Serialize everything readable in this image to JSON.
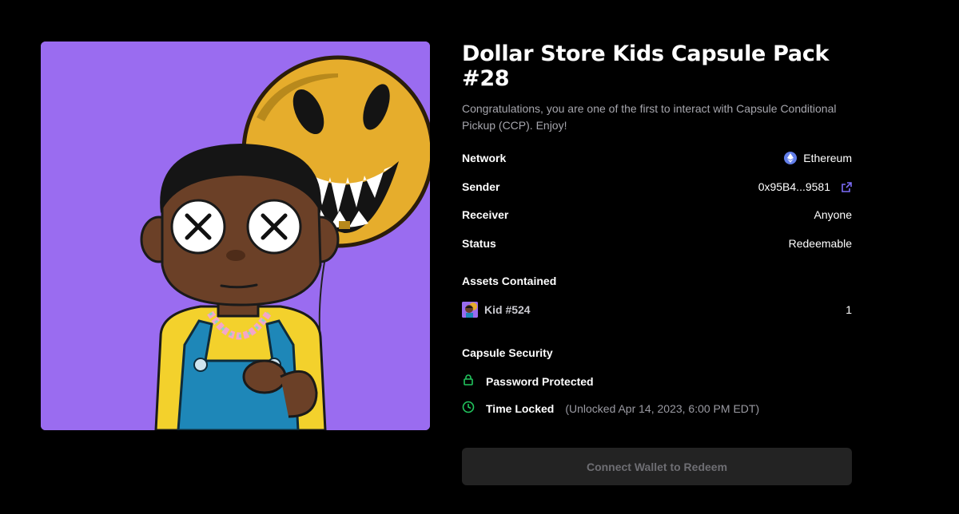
{
  "capsule": {
    "title": "Dollar Store Kids Capsule Pack #28",
    "description": "Congratulations, you are one of the first to interact with Capsule Conditional Pickup (CCP). Enjoy!"
  },
  "details": {
    "network_label": "Network",
    "network_value": "Ethereum",
    "sender_label": "Sender",
    "sender_value": "0x95B4...9581",
    "receiver_label": "Receiver",
    "receiver_value": "Anyone",
    "status_label": "Status",
    "status_value": "Redeemable"
  },
  "assets": {
    "heading": "Assets Contained",
    "items": [
      {
        "name": "Kid #524",
        "quantity": "1"
      }
    ]
  },
  "security": {
    "heading": "Capsule Security",
    "password_label": "Password Protected",
    "timelock_label": "Time Locked",
    "timelock_note": "(Unlocked Apr 14, 2023, 6:00 PM EDT)"
  },
  "actions": {
    "redeem_label": "Connect Wallet to Redeem"
  },
  "colors": {
    "background": "#000000",
    "art_background": "#9a6cf0",
    "status": "#e0624a",
    "link": "#7c6cf7",
    "security_icon": "#22c55e",
    "ethereum": "#627eea"
  },
  "icons": {
    "network": "ethereum-icon",
    "sender_link": "external-link-icon",
    "password": "lock-icon",
    "timelock": "clock-icon"
  }
}
